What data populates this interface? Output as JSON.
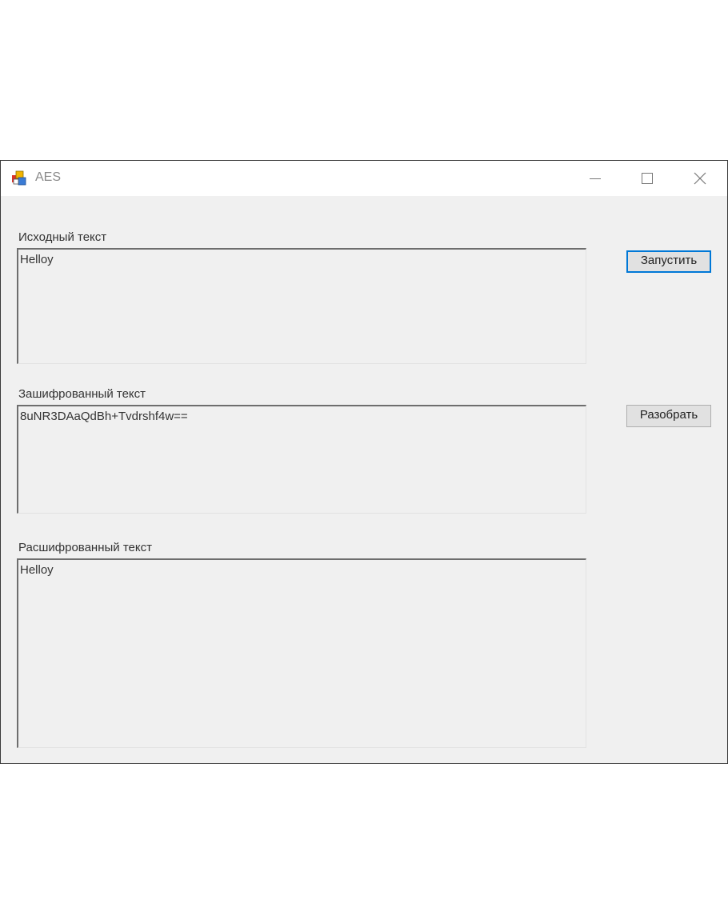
{
  "window": {
    "title": "AES"
  },
  "titlebar_controls": {
    "minimize_icon": "minimize-icon",
    "maximize_icon": "maximize-icon",
    "close_icon": "close-icon"
  },
  "form": {
    "source": {
      "label": "Исходный текст",
      "value": "Helloy"
    },
    "encrypted": {
      "label": "Зашифрованный текст",
      "value": "8uNR3DAaQdBh+Tvdrshf4w=="
    },
    "decrypted": {
      "label": "Расшифрованный текст",
      "value": "Helloy"
    }
  },
  "buttons": {
    "run_label": "Запустить",
    "parse_label": "Разобрать"
  },
  "colors": {
    "accent": "#0078d7",
    "form_background": "#f0f0f0",
    "titlebar_background": "#ffffff"
  }
}
